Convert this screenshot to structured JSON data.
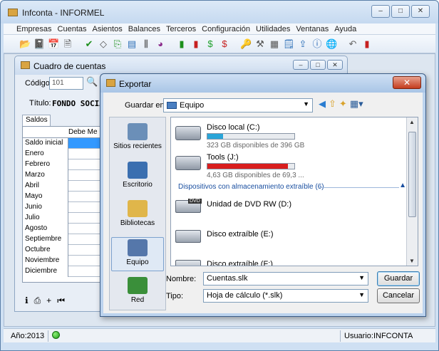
{
  "app": {
    "title": "Infconta - INFORMEL",
    "menu": [
      "Empresas",
      "Cuentas",
      "Asientos",
      "Balances",
      "Terceros",
      "Configuración",
      "Utilidades",
      "Ventanas",
      "Ayuda"
    ],
    "toolbar_icons": [
      "open-folder-icon",
      "notebook-icon",
      "calendar-icon",
      "document-icon",
      "checkmark-icon",
      "diamond-icon",
      "copy-icon",
      "ledger-icon",
      "columns-icon",
      "pie-chart-icon",
      "book-green-icon",
      "book-red-icon",
      "dollar-green-icon",
      "dollar-red-icon",
      "key-icon",
      "tools-icon",
      "calculator-icon",
      "report-icon",
      "export-icon",
      "info-icon",
      "globe-search-icon",
      "undo-icon",
      "exit-door-icon"
    ]
  },
  "status": {
    "year": "Año:2013",
    "user": "Usuario:INFCONTA"
  },
  "cuentas": {
    "title": "Cuadro de cuentas",
    "codigo_label": "Código:",
    "codigo_value": "101",
    "titulo_label": "Título:",
    "titulo_value": "FONDO SOCIAL",
    "tab_saldos": "Saldos",
    "col_debe": "Debe Me",
    "rows": [
      "Saldo inicial",
      "Enero",
      "Febrero",
      "Marzo",
      "Abril",
      "Mayo",
      "Junio",
      "Julio",
      "Agosto",
      "Septiembre",
      "Octubre",
      "Noviembre",
      "Diciembre"
    ]
  },
  "exportar": {
    "title": "Exportar",
    "save_in_label": "Guardar en:",
    "save_in_value": "Equipo",
    "places": [
      "Sitios recientes",
      "Escritorio",
      "Bibliotecas",
      "Equipo",
      "Red"
    ],
    "active_place": "Equipo",
    "drives": [
      {
        "name": "Disco local (C:)",
        "free": "323 GB disponibles de 396 GB",
        "used_fraction": 0.18,
        "bar_color": "#2aa5d8"
      },
      {
        "name": "Tools (J:)",
        "free": "4,63 GB disponibles de 69,3 ...",
        "used_fraction": 0.93,
        "bar_color": "#d81e1e"
      }
    ],
    "group_removable": "Dispositivos con almacenamiento extraíble (6)",
    "removable": [
      "Unidad de DVD RW (D:)",
      "Disco extraíble (E:)",
      "Disco extraíble (F:)"
    ],
    "dvd_badge": "DVD",
    "filename_label": "Nombre:",
    "filename_value": "Cuentas.slk",
    "type_label": "Tipo:",
    "type_value": "Hoja de cálculo (*.slk)",
    "save_button": "Guardar",
    "cancel_button": "Cancelar"
  }
}
